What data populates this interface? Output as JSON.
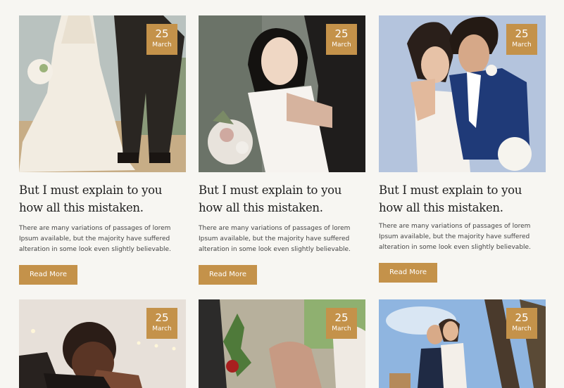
{
  "posts": [
    {
      "day": "25",
      "month": "March",
      "title": "But I must explain to you how all this mistaken.",
      "excerpt": "There are many variations of passages of lorem Ipsum available, but the majority have suffered alteration in some look even slightly believable.",
      "button": "Read More"
    },
    {
      "day": "25",
      "month": "March",
      "title": "But I must explain to you how all this mistaken.",
      "excerpt": "There are many variations of passages of lorem Ipsum available, but the majority have suffered alteration in some look even slightly believable.",
      "button": "Read More"
    },
    {
      "day": "25",
      "month": "March",
      "title": "But I must explain to you how all this mistaken.",
      "excerpt": "There are many variations of passages of lorem Ipsum available, but the majority have suffered alteration in some look even slightly believable.",
      "button": "Read More"
    },
    {
      "day": "25",
      "month": "March"
    },
    {
      "day": "25",
      "month": "March"
    },
    {
      "day": "25",
      "month": "March"
    }
  ],
  "colors": {
    "accent": "#c4924a",
    "background": "#f7f6f2",
    "text": "#1e1e1e"
  }
}
